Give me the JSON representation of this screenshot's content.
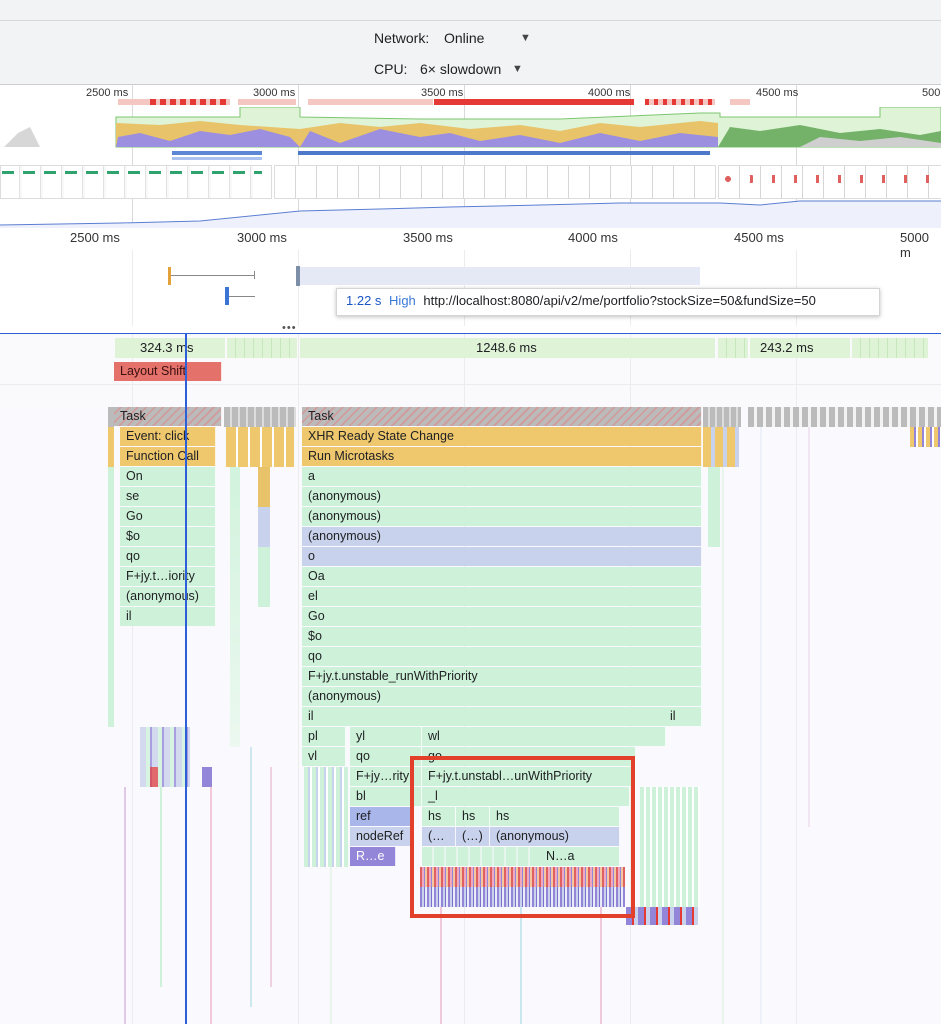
{
  "settings": {
    "network_label": "Network:",
    "network_value": "Online",
    "cpu_label": "CPU:",
    "cpu_value": "6× slowdown"
  },
  "overview": {
    "ticks": [
      "2500 ms",
      "3000 ms",
      "3500 ms",
      "4000 ms",
      "4500 ms",
      "500"
    ]
  },
  "ruler": {
    "ticks": [
      "2500 ms",
      "3000 ms",
      "3500 ms",
      "4000 ms",
      "4500 ms",
      "5000 m"
    ]
  },
  "network_tooltip": {
    "duration": "1.22 s",
    "priority": "High",
    "url": "http://localhost:8080/api/v2/me/portfolio?stockSize=50&fundSize=50"
  },
  "frames": {
    "durations": [
      "324.3 ms",
      "1248.6 ms",
      "243.2 ms"
    ]
  },
  "layout_shift": "Layout Shift",
  "flame": {
    "left": [
      "Task",
      "Event: click",
      "Function Call",
      "On",
      "se",
      "Go",
      "$o",
      "qo",
      "F+jy.t…iority",
      "(anonymous)",
      "il"
    ],
    "mid": [
      "Task",
      "XHR Ready State Change",
      "Run Microtasks",
      "a",
      "(anonymous)",
      "(anonymous)",
      "(anonymous)",
      "o",
      "Oa",
      "el",
      "Go",
      "$o",
      "qo",
      "F+jy.t.unstable_runWithPriority",
      "(anonymous)",
      "il",
      "pl",
      "vl"
    ],
    "il_right": "il",
    "c2": [
      "yl",
      "qo",
      "F+jy…rity",
      "bl",
      "ref",
      "nodeRef",
      "R…e"
    ],
    "c3": [
      "wl",
      "go",
      "F+jy.t.unstabl…unWithPriority",
      "_l"
    ],
    "hs": [
      "hs",
      "hs",
      "hs"
    ],
    "anon_row": [
      "(…",
      "(…)",
      "(anonymous)"
    ],
    "na": "N…a"
  }
}
